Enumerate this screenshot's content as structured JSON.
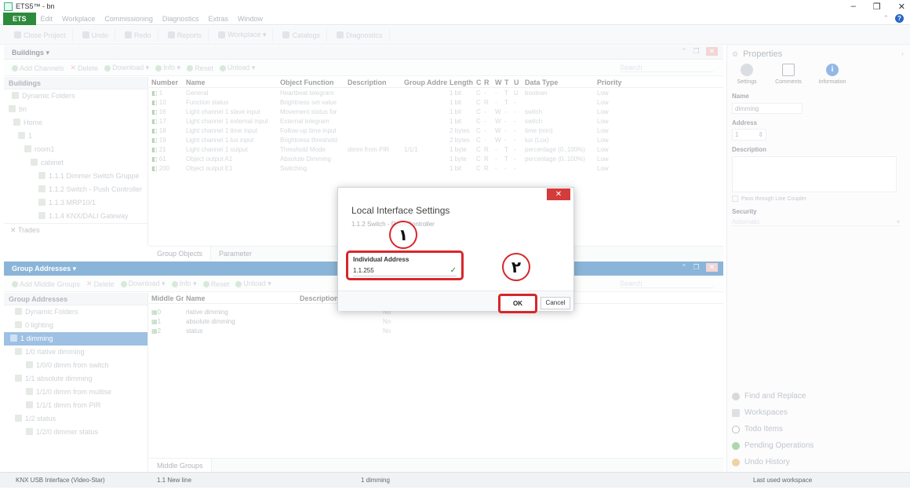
{
  "window": {
    "title": "ETS5™ - bn",
    "controls": [
      "–",
      "❐",
      "✕"
    ]
  },
  "menu": {
    "app": "ETS",
    "items": [
      "Edit",
      "Workplace",
      "Commissioning",
      "Diagnostics",
      "Extras",
      "Window"
    ]
  },
  "main_toolbar": [
    "Close Project",
    "Undo",
    "Redo",
    "Reports",
    "Workplace ▾",
    "Catalogs",
    "Diagnostics"
  ],
  "buildings": {
    "title": "Buildings ▾",
    "toolbar": [
      "Add Channels",
      "Delete",
      "Download ▾",
      "Info ▾",
      "Reset",
      "Unload ▾"
    ],
    "search_placeholder": "Search",
    "tree_header": "Buildings",
    "tree": [
      "Dynamic Folders",
      "bn",
      "Home",
      "1",
      "room1",
      "cabinet",
      "1.1.1 Dimmer Switch Gruppe",
      "1.1.2 Switch - Push Controller",
      "1.1.3 MRP10/1",
      "1.1.4 KNX/DALI Gateway"
    ],
    "trades": "Trades",
    "columns": [
      "Number",
      "Name",
      "Object Function",
      "Description",
      "Group Address",
      "Length",
      "C",
      "R",
      "W",
      "T",
      "U",
      "Data Type",
      "Priority"
    ],
    "rows": [
      [
        "1",
        "General",
        "Heartbeat telegram",
        "",
        "",
        "1 bit",
        "C",
        "-",
        "-",
        "T",
        "U",
        "boolean",
        "Low"
      ],
      [
        "10",
        "Function status",
        "Brightness set value",
        "",
        "",
        "1 bit",
        "C",
        "R",
        "-",
        "T",
        "-",
        "",
        "Low"
      ],
      [
        "16",
        "Light channel 1 slave input",
        "Movement status for",
        "",
        "",
        "1 bit",
        "C",
        "-",
        "W",
        "-",
        "-",
        "switch",
        "Low"
      ],
      [
        "17",
        "Light channel 1 external input",
        "External telegram",
        "",
        "",
        "1 bit",
        "C",
        "-",
        "W",
        "-",
        "-",
        "switch",
        "Low"
      ],
      [
        "18",
        "Light channel 1 time input",
        "Follow-up time input",
        "",
        "",
        "2 bytes",
        "C",
        "-",
        "W",
        "-",
        "-",
        "time (min)",
        "Low"
      ],
      [
        "19",
        "Light channel 1 lux input",
        "Brightness threshold",
        "",
        "",
        "2 bytes",
        "C",
        "-",
        "W",
        "-",
        "-",
        "lux (Lux)",
        "Low"
      ],
      [
        "21",
        "Light channel 1 output",
        "Threshold Mode",
        "dimm from PIR",
        "1/1/1",
        "1 byte",
        "C",
        "R",
        "-",
        "T",
        "-",
        "percentage (0..100%)",
        "Low"
      ],
      [
        "61",
        "Object output A1",
        "Absolute Dimming",
        "",
        "",
        "1 byte",
        "C",
        "R",
        "-",
        "T",
        "-",
        "percentage (0..100%)",
        "Low"
      ],
      [
        "200",
        "Object output E1",
        "Switching",
        "",
        "",
        "1 bit",
        "C",
        "R",
        "-",
        "-",
        "-",
        "",
        "Low"
      ]
    ],
    "tabs": [
      "Group Objects",
      "Parameter"
    ]
  },
  "group_addresses": {
    "title": "Group Addresses ▾",
    "toolbar": [
      "Add Middle Groups",
      "Delete",
      "Download ▾",
      "Info ▾",
      "Reset",
      "Unload ▾"
    ],
    "search_placeholder": "Search",
    "tree_header": "Group Addresses",
    "tree": [
      "Dynamic Folders",
      "0 lighting",
      "1 dimming",
      "1/0 rlative dimming",
      "1/0/0 dimm from switch",
      "1/1 absolute dimming",
      "1/1/0 dimm from multise",
      "1/1/1 dimm from PIR",
      "1/2 status",
      "1/2/0 dimmer status"
    ],
    "columns": [
      "Middle Gr",
      "Name",
      "Description"
    ],
    "rows": [
      [
        "0",
        "rlative dimming",
        "",
        "No"
      ],
      [
        "1",
        "absolute dimming",
        "",
        "No"
      ],
      [
        "2",
        "status",
        "",
        "No"
      ]
    ],
    "tab": "Middle Groups"
  },
  "properties": {
    "title": "Properties",
    "tabs": [
      "Settings",
      "Comments",
      "Information"
    ],
    "name_label": "Name",
    "name_value": "dimming",
    "address_label": "Address",
    "address_value": "1",
    "description_label": "Description",
    "pass_through": "Pass through Line Coupler",
    "security_label": "Security",
    "security_value": "Automatic"
  },
  "bottom_nav": [
    "Find and Replace",
    "Workspaces",
    "Todo Items",
    "Pending Operations",
    "Undo History"
  ],
  "status_bar": {
    "interface": "KNX USB Interface (Video-Star)",
    "line": "1.1 New line",
    "selected": "1 dimming",
    "workspace": "Last used workspace"
  },
  "dialog": {
    "close": "✕",
    "title": "Local Interface Settings",
    "subtitle": "1.1.2 Switch - Push Controller",
    "ia_label": "Individual Address",
    "ia_value": "1.1.255",
    "check": "✓",
    "ok": "OK",
    "cancel": "Cancel"
  },
  "markers": [
    "۱",
    "۲"
  ],
  "colors": {
    "accent": "#2d79b8",
    "highlight": "#d8262b",
    "ets_green": "#2e8b3c"
  }
}
